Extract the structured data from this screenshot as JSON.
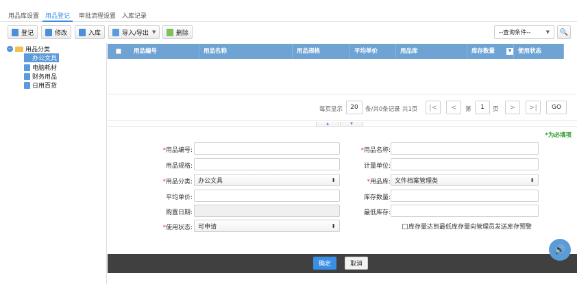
{
  "tabs": [
    {
      "label": "用品库设置"
    },
    {
      "label": "用品登记"
    },
    {
      "label": "审批流程设置"
    },
    {
      "label": "入库记录"
    }
  ],
  "toolbar": {
    "register_label": "登记",
    "edit_label": "修改",
    "stockin_label": "入库",
    "import_export_label": "导入/导出",
    "delete_label": "删除",
    "query_label": "--查询条件--"
  },
  "tree": {
    "root_label": "用品分类",
    "items": [
      {
        "label": "办公文具"
      },
      {
        "label": "电脑耗材"
      },
      {
        "label": "财务用品"
      },
      {
        "label": "日用百货"
      }
    ]
  },
  "grid": {
    "columns": [
      "用品编号",
      "用品名称",
      "用品规格",
      "平均单价",
      "用品库",
      "库存数量",
      "使用状态"
    ]
  },
  "pager": {
    "per_page_label": "每页显示",
    "per_page_value": "20",
    "records_label": "条/共0条记录",
    "pages_label": "共1页",
    "page_prefix": "第",
    "page_value": "1",
    "page_suffix": "页",
    "go_label": "GO"
  },
  "form": {
    "required_note": "*为必填项",
    "code_label": "用品编号:",
    "name_label": "用品名称:",
    "spec_label": "用品规格:",
    "unit_label": "计量单位:",
    "category_label": "用品分类:",
    "category_value": "办公文具",
    "store_label": "用品库:",
    "store_value": "文件档案管理类",
    "price_label": "平均单价:",
    "qty_label": "库存数量:",
    "date_label": "购置日期:",
    "minqty_label": "最低库存:",
    "status_label": "使用状态:",
    "status_value": "可申请",
    "alert_label": "库存量达到最低库存量向管理员发送库存预警"
  },
  "footer": {
    "ok_label": "确定",
    "cancel_label": "取消"
  },
  "icons": {
    "speaker": "speaker-icon"
  }
}
